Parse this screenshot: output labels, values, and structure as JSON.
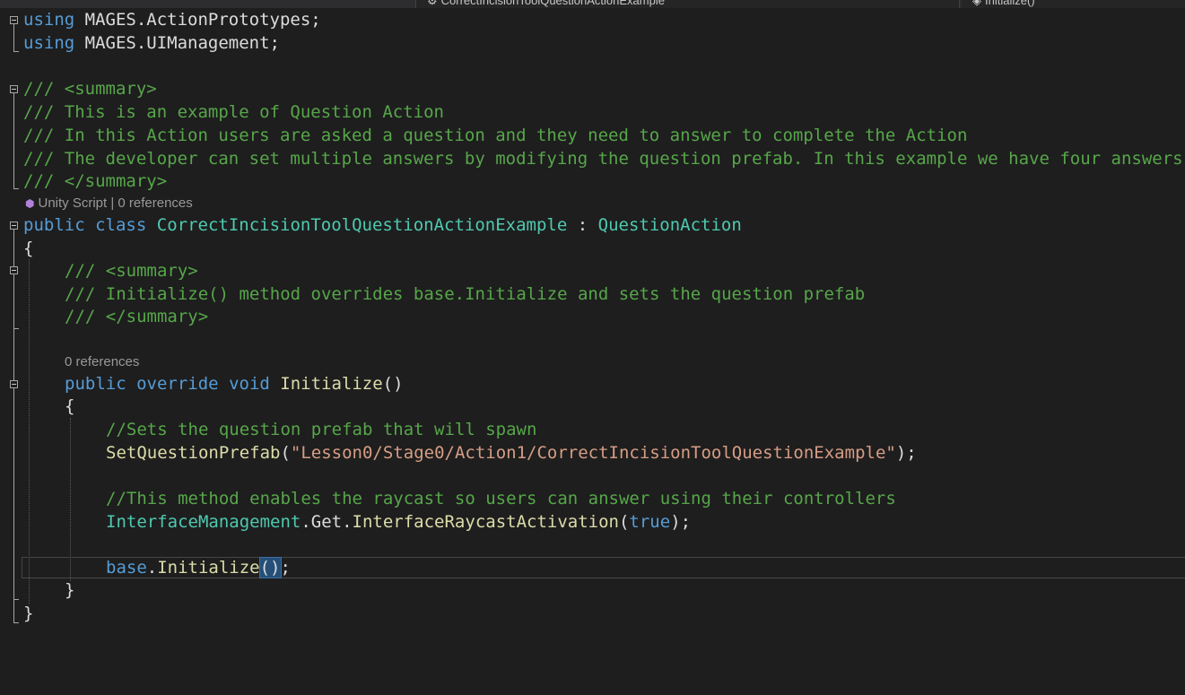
{
  "tabs": {
    "class_tab": "CorrectIncisionToolQuestionActionExample",
    "member_tab": "Initialize()"
  },
  "code": {
    "using1_kw": "using",
    "using1_ns": " MAGES.ActionPrototypes;",
    "using2_kw": "using",
    "using2_ns": " MAGES.UIManagement;",
    "doc1": "/// <summary>",
    "doc2": "/// This is an example of Question Action",
    "doc3": "/// In this Action users are asked a question and they need to answer to complete the Action",
    "doc4": "/// The developer can set multiple answers by modifying the question prefab. In this example we have four answers",
    "doc5": "/// </summary>",
    "codelens_class_icon": "unity-cube-icon",
    "codelens_class": "Unity Script | 0 references",
    "class_kw_public": "public",
    "class_kw_class": "class",
    "class_name": "CorrectIncisionToolQuestionActionExample",
    "class_colon": " : ",
    "class_base": "QuestionAction",
    "open_brace": "{",
    "mdoc1": "/// <summary>",
    "mdoc2": "/// Initialize() method overrides base.Initialize and sets the question prefab",
    "mdoc3": "/// </summary>",
    "codelens_method": "0 references",
    "m_public": "public",
    "m_override": "override",
    "m_void": "void",
    "m_name": "Initialize",
    "m_parens": "()",
    "m_open": "{",
    "c1": "//Sets the question prefab that will spawn",
    "call1_name": "SetQuestionPrefab",
    "call1_open": "(",
    "call1_arg": "\"Lesson0/Stage0/Action1/CorrectIncisionToolQuestionExample\"",
    "call1_close": ");",
    "c2": "//This method enables the raycast so users can answer using their controllers",
    "call2_type": "InterfaceManagement",
    "call2_get": ".Get.",
    "call2_name": "InterfaceRaycastActivation",
    "call2_open": "(",
    "call2_arg": "true",
    "call2_close": ");",
    "call3_base": "base",
    "call3_dot": ".",
    "call3_name": "Initialize",
    "call3_parens": "()",
    "call3_semi": ";",
    "m_close": "}",
    "close_brace": "}"
  },
  "colors": {
    "background": "#1e1e1e",
    "keyword": "#569cd6",
    "type": "#4ec9b0",
    "method": "#dcdcaa",
    "string": "#d69d85",
    "comment": "#57a64a",
    "plain": "#dcdcdc"
  }
}
